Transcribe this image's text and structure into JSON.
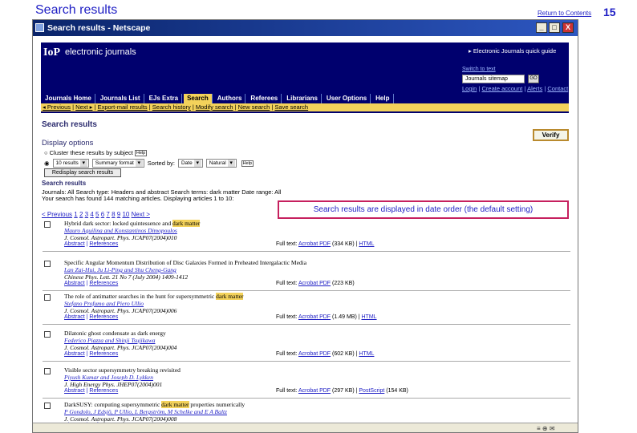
{
  "slide": {
    "title": "Search results",
    "return_text": "Return to Contents",
    "page_number": "15"
  },
  "window": {
    "title": "Search results - Netscape",
    "minimize": "_",
    "maximize": "□",
    "close": "X"
  },
  "banner": {
    "logo": "IoP",
    "site_name": "electronic journals",
    "quick_guide": "▸ Electronic Journals quick guide",
    "switch_journal": "Switch to text",
    "journal_select": "Journals sitemap",
    "go": "GO",
    "login": "Login",
    "create_account": "Create account",
    "alerts": "Alerts",
    "contact_us": "Contact us"
  },
  "nav": {
    "tabs": [
      "Journals Home",
      "Journals List",
      "EJs Extra",
      "Search",
      "Authors",
      "Referees",
      "Librarians",
      "User Options",
      "Help"
    ],
    "active_index": 3
  },
  "subnav": {
    "items": [
      "◂ Previous",
      "Next ▸",
      "Export-mail results",
      "Search history",
      "Modify search",
      "New search",
      "Save search"
    ]
  },
  "page": {
    "heading": "Search results",
    "verify_button": "Verify",
    "display_options": "Display options",
    "cluster_label": "Cluster these results by subject",
    "show_label": "10 results",
    "format_select": "Summary format",
    "sorted_by_label": "Sorted by:",
    "sort_select": "Date",
    "order_select": "Natural",
    "help": "Help",
    "redisplay_button": "Redisplay search results",
    "subheading": "Search results",
    "summary_line1": "Journals: All Search type: Headers and abstract Search terms: dark matter Date range: All",
    "summary_line2": "Your search has found 144 matching articles. Displaying articles 1 to 10:",
    "pager": {
      "previous": "< Previous",
      "pages": [
        "1",
        "2",
        "3",
        "4",
        "5",
        "6",
        "7",
        "8",
        "9",
        "10"
      ],
      "next": "Next >"
    }
  },
  "callout": {
    "text": "Search results are displayed in date order (the default setting)"
  },
  "results": [
    {
      "title": "Hybrid dark sector: locked quintessence and dark matter",
      "authors": "Mauro Aquilina and Konstantinos Dimopoulos",
      "reference": "J. Cosmol. Astropart. Phys. JCAP07(2004)010",
      "abstract": "Abstract",
      "references": "References",
      "fulltext_label": "Full text:",
      "pdf": "Acrobat PDF",
      "pdf_size": "(334 KB)",
      "alt": "HTML",
      "alt_size": ""
    },
    {
      "title": "Specific Angular Momentum Distribution of Disc Galaxies Formed in Preheated Intergalactic Media",
      "authors": "Lan Zai-Hui, Ju Li-Ping and Shu Cheng-Gang",
      "reference": "Chinese Phys. Lett. 21 No 7 (July 2004) 1409-1412",
      "abstract": "Abstract",
      "references": "References",
      "fulltext_label": "Full text:",
      "pdf": "Acrobat PDF",
      "pdf_size": "(223 KB)",
      "alt": "",
      "alt_size": ""
    },
    {
      "title": "The role of antimatter searches in the hunt for supersymmetric dark matter",
      "authors": "Stefano Profumo and Piero Ullio",
      "reference": "J. Cosmol. Astropart. Phys. JCAP07(2004)006",
      "abstract": "Abstract",
      "references": "References",
      "fulltext_label": "Full text:",
      "pdf": "Acrobat PDF",
      "pdf_size": "(1.49 MB)",
      "alt": "HTML",
      "alt_size": ""
    },
    {
      "title": "Dilatonic ghost condensate as dark energy",
      "authors": "Federico Piazza and Shinji Tsujikawa",
      "reference": "J. Cosmol. Astropart. Phys. JCAP07(2004)004",
      "abstract": "Abstract",
      "references": "References",
      "fulltext_label": "Full text:",
      "pdf": "Acrobat PDF",
      "pdf_size": "(602 KB)",
      "alt": "HTML",
      "alt_size": ""
    },
    {
      "title": "Visible sector supersymmetry breaking revisited",
      "authors": "Piyush Kumar and Joseph D. Lykken",
      "reference": "J. High Energy Phys. JHEP07(2004)001",
      "abstract": "Abstract",
      "references": "References",
      "fulltext_label": "Full text:",
      "pdf": "Acrobat PDF",
      "pdf_size": "(297 KB)",
      "alt": "PostScript",
      "alt_size": "(154 KB)"
    },
    {
      "title": "DarkSUSY: computing supersymmetric dark matter properties numerically",
      "authors": "P Gondolo, J Edsjö, P Ullio, L Bergström, M Schelke and E A Baltz",
      "reference": "J. Cosmol. Astropart. Phys. JCAP07(2004)008",
      "abstract": "Abstract",
      "references": "References",
      "fulltext_label": "",
      "pdf": "",
      "pdf_size": "",
      "alt": "",
      "alt_size": ""
    }
  ],
  "statusbar": {
    "icons": "≡ ⊕ ✉"
  }
}
